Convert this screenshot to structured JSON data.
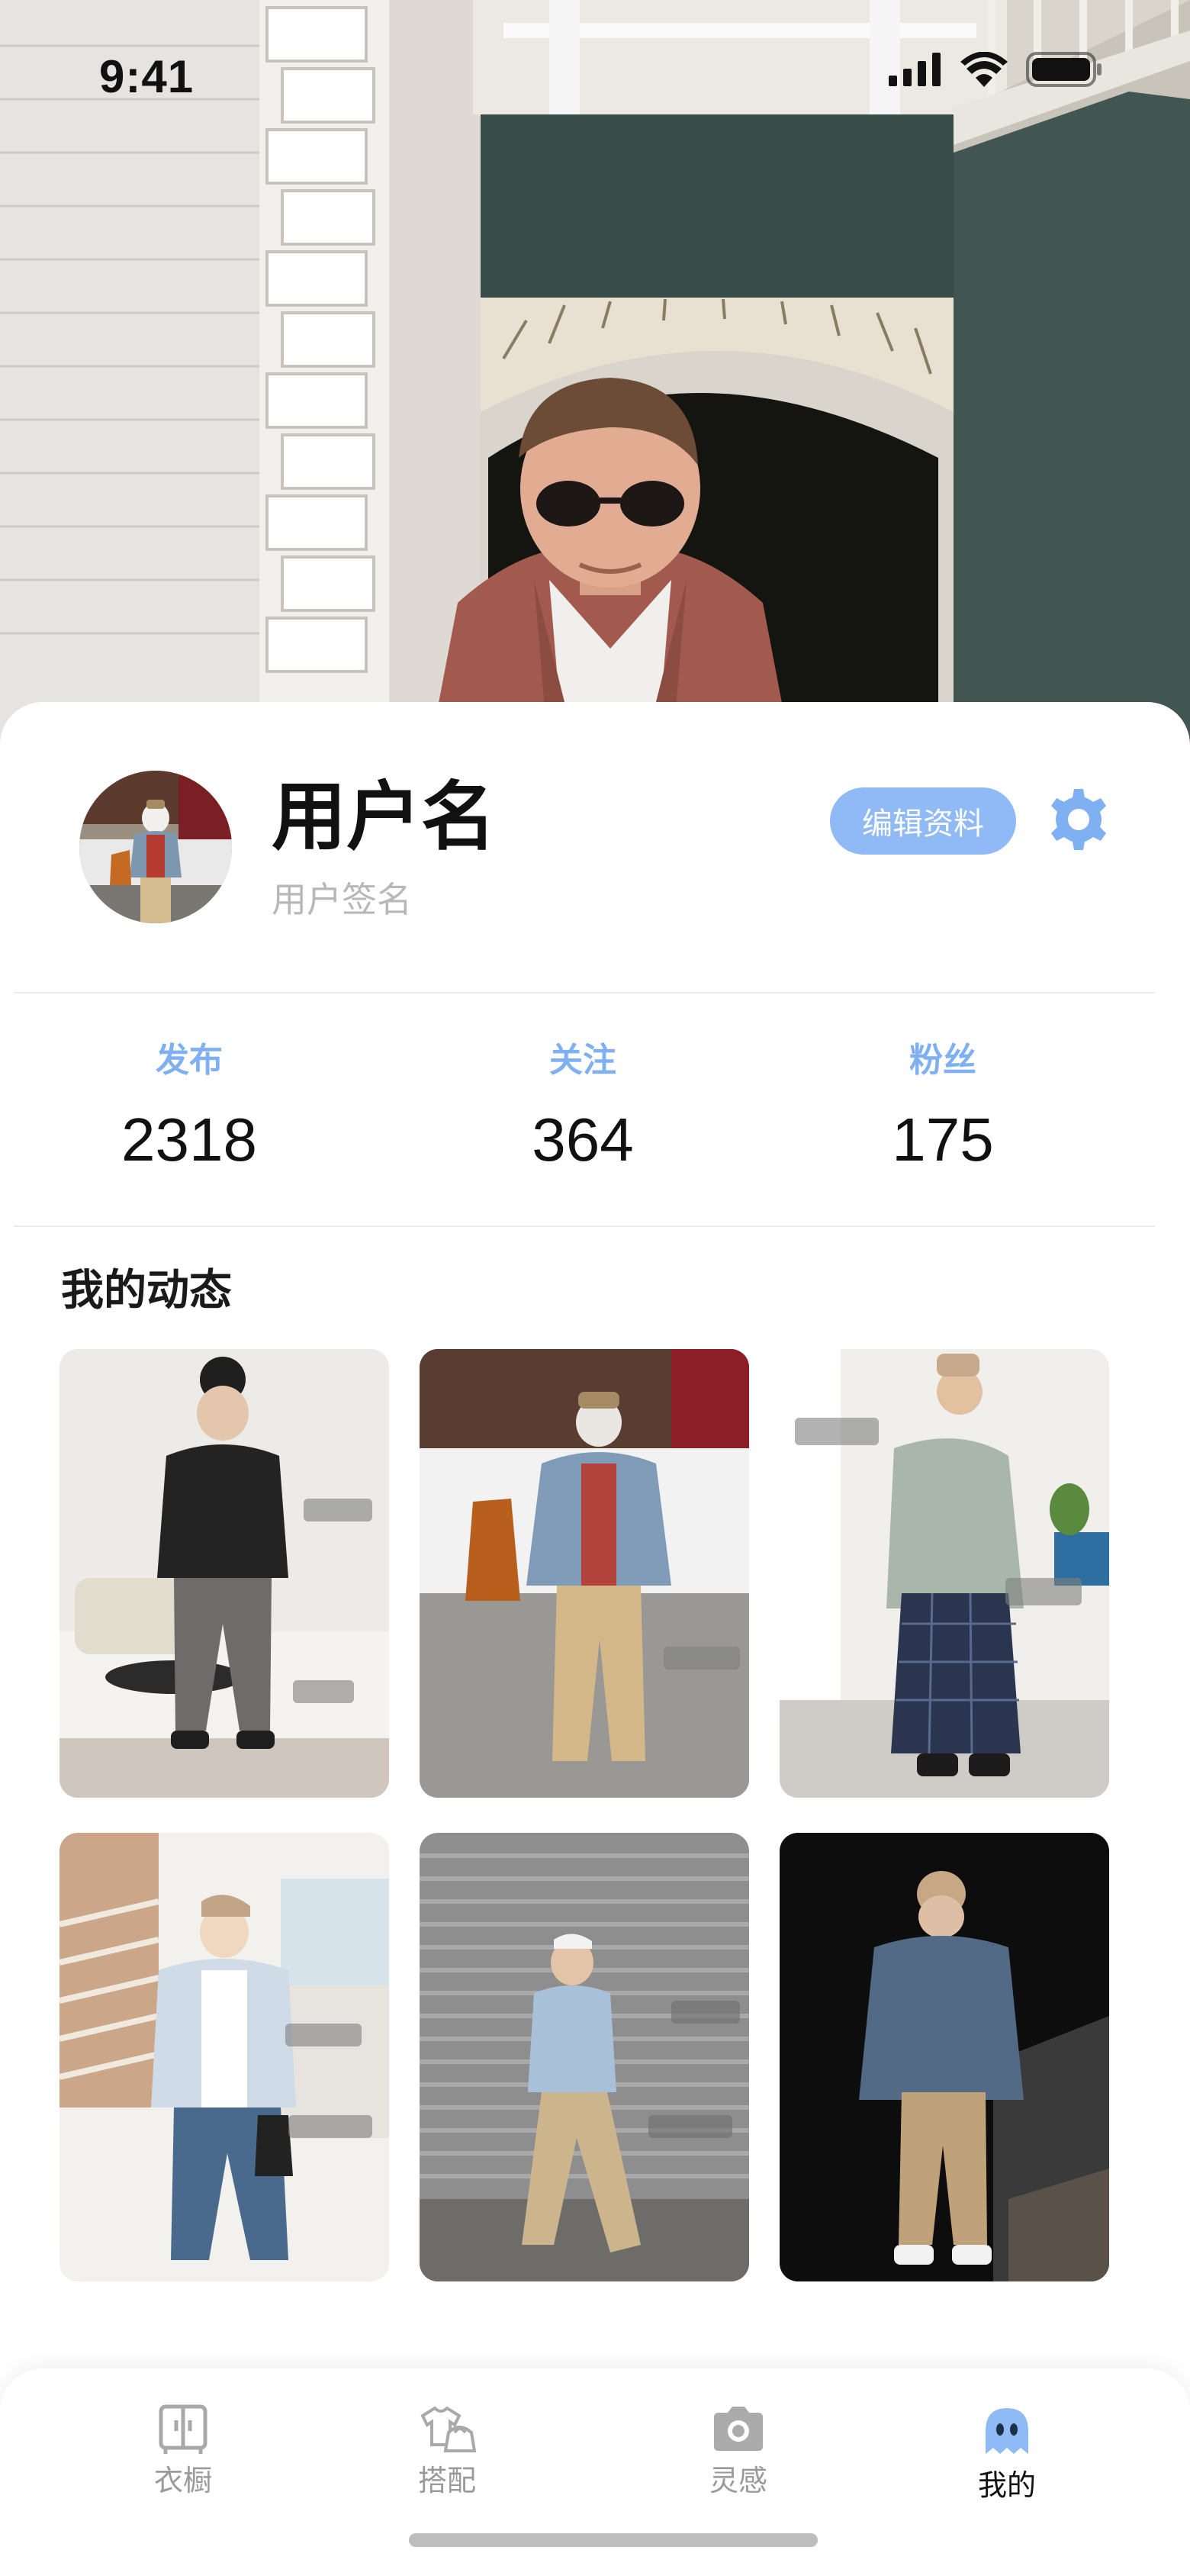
{
  "status_bar": {
    "time": "9:41"
  },
  "profile": {
    "username": "用户名",
    "signature": "用户签名",
    "edit_button": "编辑资料"
  },
  "stats": [
    {
      "label": "发布",
      "value": "2318"
    },
    {
      "label": "关注",
      "value": "364"
    },
    {
      "label": "粉丝",
      "value": "175"
    }
  ],
  "feed": {
    "title": "我的动态"
  },
  "nav": [
    {
      "label": "衣橱",
      "icon": "wardrobe-icon",
      "active": false
    },
    {
      "label": "搭配",
      "icon": "outfit-icon",
      "active": false
    },
    {
      "label": "灵感",
      "icon": "camera-icon",
      "active": false
    },
    {
      "label": "我的",
      "icon": "ghost-icon",
      "active": true
    }
  ],
  "colors": {
    "accent": "#7fb0f2",
    "edit_button_bg": "#8fbaf6",
    "text": "#111111",
    "muted": "#b8b8bc"
  }
}
